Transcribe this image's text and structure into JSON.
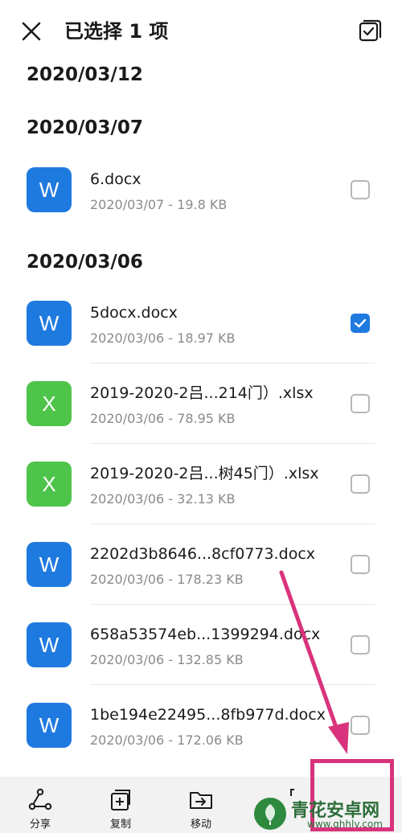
{
  "header": {
    "title": "已选择 1 项"
  },
  "groups": [
    {
      "date": "2020/03/12"
    },
    {
      "date": "2020/03/07"
    },
    {
      "date": "2020/03/06"
    }
  ],
  "files": [
    {
      "icon_letter": "W",
      "type": "word",
      "name": "6.docx",
      "meta": "2020/03/07 - 19.8 KB",
      "checked": false
    },
    {
      "icon_letter": "W",
      "type": "word",
      "name": "5docx.docx",
      "meta": "2020/03/06 - 18.97 KB",
      "checked": true
    },
    {
      "icon_letter": "X",
      "type": "excel",
      "name": "2019-2020-2吕...214门）.xlsx",
      "meta": "2020/03/06 - 78.95 KB",
      "checked": false
    },
    {
      "icon_letter": "X",
      "type": "excel",
      "name": "2019-2020-2吕...树45门）.xlsx",
      "meta": "2020/03/06 - 32.13 KB",
      "checked": false
    },
    {
      "icon_letter": "W",
      "type": "word",
      "name": "2202d3b8646...8cf0773.docx",
      "meta": "2020/03/06 - 178.23 KB",
      "checked": false
    },
    {
      "icon_letter": "W",
      "type": "word",
      "name": "658a53574eb...1399294.docx",
      "meta": "2020/03/06 - 132.85 KB",
      "checked": false
    },
    {
      "icon_letter": "W",
      "type": "word",
      "name": "1be194e22495...8fb977d.docx",
      "meta": "2020/03/06 - 172.06 KB",
      "checked": false
    }
  ],
  "toolbar": {
    "share_label": "分享",
    "copy_label": "复制",
    "move_label": "移动"
  },
  "watermark": {
    "name": "青花安卓网",
    "url": "www.qhhlv.com"
  },
  "colors": {
    "accent": "#1f7ae0",
    "excel": "#4fc44a",
    "annotation": "#d8337c"
  }
}
